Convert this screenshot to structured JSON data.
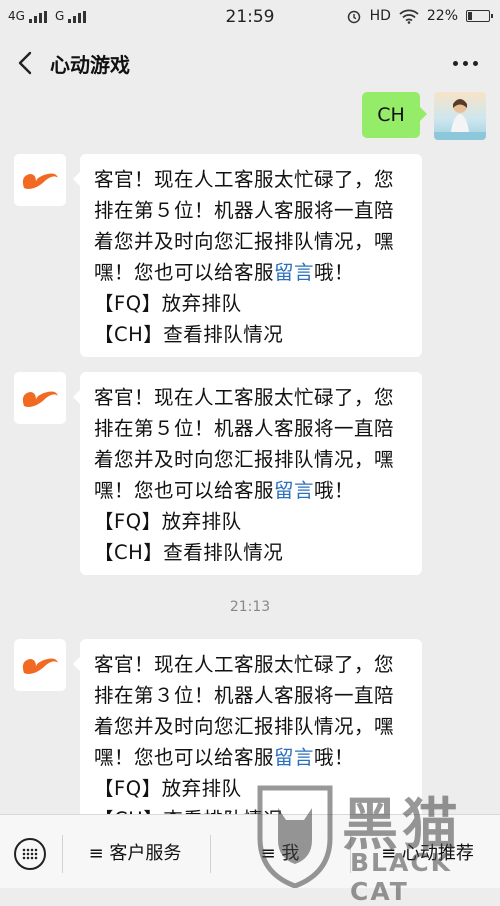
{
  "status_bar": {
    "net1": "4G",
    "net2": "G",
    "time": "21:59",
    "hd": "HD",
    "battery": "22%",
    "battery_level": 0.22
  },
  "nav": {
    "title": "心动游戏"
  },
  "chat": {
    "user_message": "CH",
    "messages": [
      {
        "lines": [
          "客官！现在人工客服太忙碌了，您",
          "排在第５位！机器人客服将一直陪",
          "着您并及时向您汇报排队情况，嘿"
        ],
        "pre_link": "嘿！您也可以给客服",
        "link": "留言",
        "post_link": "哦！",
        "option1": "【FQ】放弃排队",
        "option2": "【CH】查看排队情况"
      },
      {
        "lines": [
          "客官！现在人工客服太忙碌了，您",
          "排在第５位！机器人客服将一直陪",
          "着您并及时向您汇报排队情况，嘿"
        ],
        "pre_link": "嘿！您也可以给客服",
        "link": "留言",
        "post_link": "哦！",
        "option1": "【FQ】放弃排队",
        "option2": "【CH】查看排队情况"
      },
      {
        "lines": [
          "客官！现在人工客服太忙碌了，您",
          "排在第３位！机器人客服将一直陪",
          "着您并及时向您汇报排队情况，嘿"
        ],
        "pre_link": "嘿！您也可以给客服",
        "link": "留言",
        "post_link": "哦！",
        "option1": "【FQ】放弃排队",
        "option2": "【CH】查看排队情况"
      }
    ],
    "timestamp": "21:13"
  },
  "bottom_bar": {
    "tab1": "≡ 客户服务",
    "tab2": "≡ 我",
    "tab3": "≡ 心动推荐"
  },
  "watermark": {
    "cn": "黑猫",
    "en": "BLACK CAT"
  },
  "colors": {
    "background": "#ededed",
    "user_bubble": "#95ec69",
    "link": "#2b6fbf",
    "bot_logo": "#f26a21"
  },
  "icons": [
    "back-arrow-icon",
    "more-icon",
    "keyboard-icon",
    "bot-logo-icon",
    "wifi-icon",
    "alarm-icon"
  ]
}
